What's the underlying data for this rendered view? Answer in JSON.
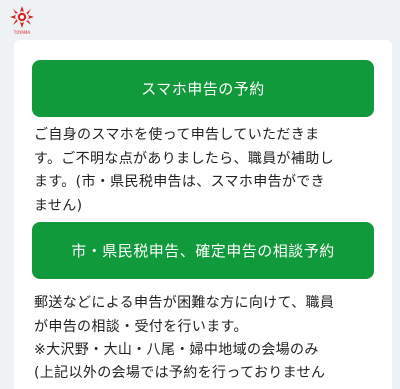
{
  "logo": {
    "text": "TOYAMA",
    "color": "#d7261e"
  },
  "buttons": {
    "smartphone_reservation": "スマホ申告の予約",
    "consultation_reservation": "市・県民税申告、確定申告の相談予約"
  },
  "descriptions": {
    "smartphone_lines": [
      "ご自身のスマホを使って申告していただきま",
      "す。ご不明な点がありましたら、職員が補助し",
      "ます。(市・県民税申告は、スマホ申告ができ",
      "ません)"
    ],
    "consultation_lines": [
      "郵送などによる申告が困難な方に向けて、職員",
      "が申告の相談・受付を行います。"
    ],
    "note_line1": "※大沢野・大山・八尾・婦中地域の会場のみ",
    "note_line2": "(上記以外の会場では予約を行っておりません"
  },
  "colors": {
    "button_bg": "#119a3c",
    "button_text": "#ffffff",
    "background": "#eef2f5",
    "card": "#ffffff"
  }
}
